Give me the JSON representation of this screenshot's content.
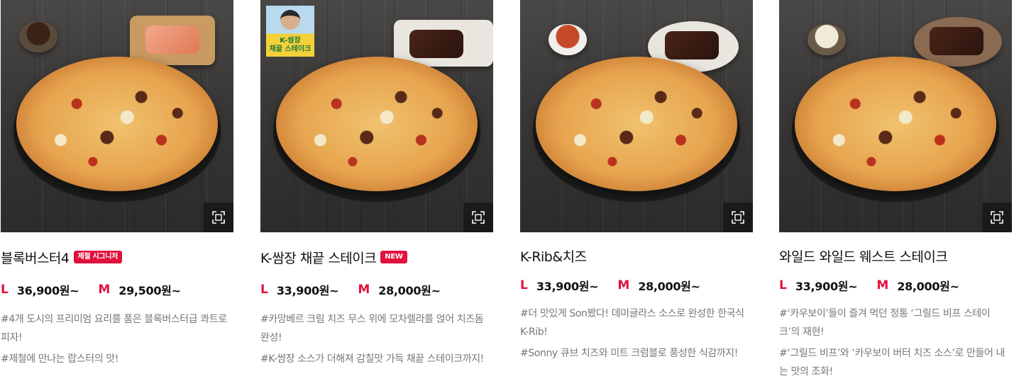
{
  "colors": {
    "accent": "#e0113e",
    "zoom_button_bg": "#222222",
    "title_text": "#111111",
    "description_text": "#777777"
  },
  "icons": {
    "zoom": "expand-frame-icon"
  },
  "products": [
    {
      "name": "블록버스터4",
      "badge": "제철 시그니처",
      "large_label": "L",
      "large_price": "36,900원~",
      "medium_label": "M",
      "medium_price": "29,500원~",
      "desc1": "#4개 도시의 프리미엄 요리를 품은 블록버스터급 콰트로 피자!",
      "desc2": "#제철에 만나는 랍스터의 맛!"
    },
    {
      "name": "K-쌈장 채끝 스테이크",
      "badge": "NEW",
      "promo_line1": "K-쌈장",
      "promo_line2": "채끝 스테이크",
      "large_label": "L",
      "large_price": "33,900원~",
      "medium_label": "M",
      "medium_price": "28,000원~",
      "desc1": "#카망베르 크림 치즈 무스 위에 모차렐라를 얹어 치즈돔 완성!",
      "desc2": "#K-쌈장 소스가 더해져 감칠맛 가득 채끝 스테이크까지!"
    },
    {
      "name": "K-Rib&치즈",
      "large_label": "L",
      "large_price": "33,900원~",
      "medium_label": "M",
      "medium_price": "28,000원~",
      "desc1": "#더 맛있게 Son봤다! 데미글라스 소스로 완성한 한국식 K-Rib!",
      "desc2": "#Sonny 큐브 치즈와 미트 크럼블로 풍성한 식감까지!"
    },
    {
      "name": "와일드 와일드 웨스트 스테이크",
      "large_label": "L",
      "large_price": "33,900원~",
      "medium_label": "M",
      "medium_price": "28,000원~",
      "desc1": "#‘카우보이’들이 즐겨 먹던 정통 ‘그릴드 비프 스테이크’의 재현!",
      "desc2": "#‘그릴드 비프’와 ‘카우보이 버터 치즈 소스’로 만들어 내는 맛의 조화!"
    }
  ]
}
